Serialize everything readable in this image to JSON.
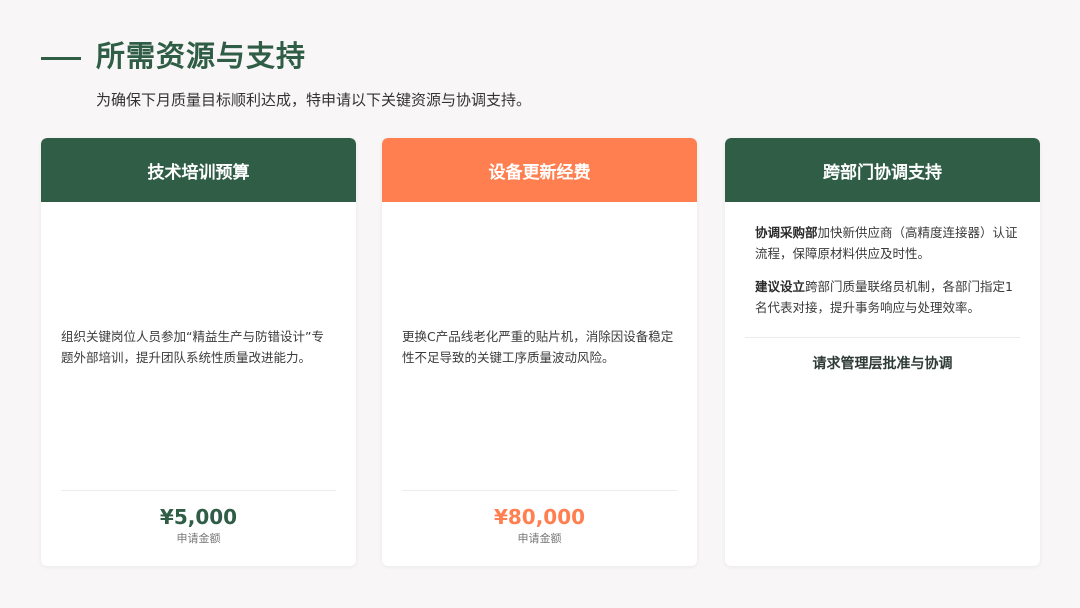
{
  "title": "所需资源与支持",
  "subtitle": "为确保下月质量目标顺利达成，特申请以下关键资源与协调支持。",
  "colors": {
    "primary_green": "#2f5d46",
    "accent_orange": "#ff7f50",
    "background": "#f8f6f6"
  },
  "cards": [
    {
      "header": "技术培训预算",
      "description": "组织关键岗位人员参加“精益生产与防错设计”专题外部培训，提升团队系统性质量改进能力。",
      "amount": "¥5,000",
      "amount_label": "申请金额"
    },
    {
      "header": "设备更新经费",
      "description": "更换C产品线老化严重的贴片机，消除因设备稳定性不足导致的关键工序质量波动风险。",
      "amount": "¥80,000",
      "amount_label": "申请金额"
    },
    {
      "header": "跨部门协调支持",
      "items": [
        {
          "bold": "协调采购部",
          "text": "加快新供应商（高精度连接器）认证流程，保障原材料供应及时性。"
        },
        {
          "bold": "建议设立",
          "text": "跨部门质量联络员机制，各部门指定1名代表对接，提升事务响应与处理效率。"
        }
      ],
      "request": "请求管理层批准与协调"
    }
  ]
}
